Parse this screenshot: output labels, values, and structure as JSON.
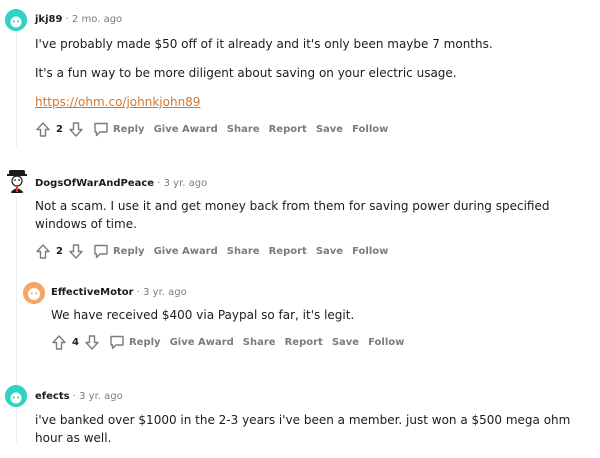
{
  "comments": [
    {
      "author": "jkj89",
      "time": "2 mo. ago",
      "paragraphs": [
        "I've probably made $50 off of it already and it's only been maybe 7 months.",
        "It's a fun way to be more diligent about saving on your electric usage."
      ],
      "link": "https://ohm.co/johnkjohn89",
      "score": "2",
      "avatar_color": "#2ed3c4"
    },
    {
      "author": "DogsOfWarAndPeace",
      "time": "3 yr. ago",
      "paragraphs": [
        "Not a scam. I use it and get money back from them for saving power during specified windows of time."
      ],
      "score": "2",
      "avatar_color": "#ffffff"
    },
    {
      "author": "EffectiveMotor",
      "time": "3 yr. ago",
      "paragraphs": [
        "We have received $400 via Paypal so far, it's legit."
      ],
      "score": "4",
      "avatar_color": "#f3a66a"
    },
    {
      "author": "efects",
      "time": "3 yr. ago",
      "paragraphs": [
        "i've banked over $1000 in the 2-3 years i've been a member. just won a $500 mega ohm hour as well."
      ],
      "avatar_color": "#2ed3c4"
    }
  ],
  "actions": {
    "reply": "Reply",
    "give_award": "Give Award",
    "share": "Share",
    "report": "Report",
    "save": "Save",
    "follow": "Follow"
  },
  "separator": "·",
  "colors": {
    "link": "#d6752a",
    "meta_gray": "#7c7c7c",
    "thread_line": "#edeff1"
  },
  "icons": [
    "upvote-icon",
    "downvote-icon",
    "reply-icon",
    "avatar-icon"
  ]
}
